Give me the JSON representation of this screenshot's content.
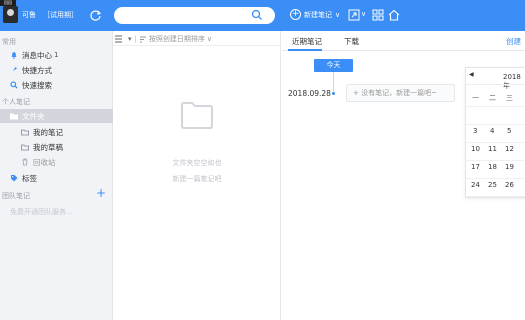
{
  "topbar": {
    "avatar_tag": "回回",
    "username": "可鲁",
    "trial": "［试用期］",
    "search_value": "",
    "new_note_label": "新建笔记",
    "new_note_dropdown": "∨",
    "search_dropdown": "∨",
    "colors": {
      "bar": "#3a8ef6"
    },
    "icons": [
      "sync-icon",
      "search-icon",
      "add-circle-icon",
      "expand-icon",
      "grid-icon",
      "home-icon"
    ]
  },
  "sidebar": {
    "section_common": "常用",
    "items": [
      {
        "label": "消息中心",
        "badge": "1",
        "icon": "bell-icon"
      },
      {
        "label": "快捷方式",
        "icon": "rocket-icon"
      },
      {
        "label": "快速搜索",
        "icon": "search-icon"
      }
    ],
    "section_personal": "个人笔记",
    "folder_label": "文件夹",
    "sub_items": [
      {
        "label": "我的笔记",
        "icon": "folder-icon"
      },
      {
        "label": "我的草稿",
        "icon": "folder-icon"
      },
      {
        "label": "回收站",
        "icon": "trash-icon"
      }
    ],
    "tags_label": "标签",
    "section_team": "团队笔记",
    "team_placeholder": "免费开通团队服务..."
  },
  "list": {
    "sort_label": "按照创建日期排序",
    "empty_line1": "文件夹空空如也",
    "empty_line2": "新建一篇笔记吧"
  },
  "main": {
    "tab_recent": "近期笔记",
    "tab_download": "下载",
    "tab_create": "创建",
    "today_label": "今天",
    "date": "2018.09.28",
    "no_note_text": "没有笔记，新建一篇吧~"
  },
  "calendar": {
    "title": "2018年",
    "prev": "◀",
    "weekdays": [
      "一",
      "二",
      "三"
    ],
    "rows": [
      [
        "",
        "",
        ""
      ],
      [
        "3",
        "4",
        "5"
      ],
      [
        "10",
        "11",
        "12"
      ],
      [
        "17",
        "18",
        "19"
      ],
      [
        "24",
        "25",
        "26"
      ]
    ]
  }
}
